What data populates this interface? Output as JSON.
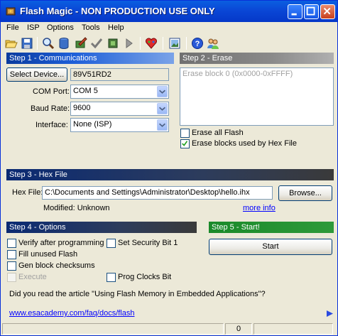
{
  "window": {
    "title": "Flash Magic - NON PRODUCTION USE ONLY"
  },
  "menu": {
    "items": [
      "File",
      "ISP",
      "Options",
      "Tools",
      "Help"
    ]
  },
  "toolbar": {
    "icons": [
      "open-icon",
      "save-icon",
      "search-icon",
      "chip-icon",
      "edit-icon",
      "verify-check-icon",
      "program-icon",
      "go-arrow-icon",
      "heart-icon",
      "image-icon",
      "help-icon",
      "users-icon"
    ]
  },
  "step1": {
    "header": "Step 1 - Communications",
    "select_device_label": "Select Device...",
    "device_value": "89V51RD2",
    "com_port_label": "COM Port:",
    "com_port_value": "COM 5",
    "baud_rate_label": "Baud Rate:",
    "baud_rate_value": "9600",
    "interface_label": "Interface:",
    "interface_value": "None (ISP)"
  },
  "step2": {
    "header": "Step 2 - Erase",
    "erase_block_item": "Erase block 0 (0x0000-0xFFFF)",
    "erase_all_label": "Erase all Flash",
    "erase_all_checked": false,
    "erase_used_label": "Erase blocks used by Hex File",
    "erase_used_checked": true
  },
  "step3": {
    "header": "Step 3 - Hex File",
    "hex_file_label": "Hex File:",
    "hex_file_value": "C:\\Documents and Settings\\Administrator\\Desktop\\hello.ihx",
    "browse_label": "Browse...",
    "modified_text": "Modified: Unknown",
    "more_info_label": "more info"
  },
  "step4": {
    "header": "Step 4 - Options",
    "verify_label": "Verify after programming",
    "set_security_label": "Set Security Bit 1",
    "fill_unused_label": "Fill unused Flash",
    "gen_checksums_label": "Gen block checksums",
    "execute_label": "Execute",
    "prog_clocks_label": "Prog Clocks Bit"
  },
  "step5": {
    "header": "Step 5 - Start!",
    "start_label": "Start"
  },
  "footer": {
    "article_text": "Did you read the article \"Using Flash Memory in Embedded Applications\"?",
    "link_text": "www.esacademy.com/faq/docs/flash"
  },
  "status": {
    "count": "0"
  }
}
